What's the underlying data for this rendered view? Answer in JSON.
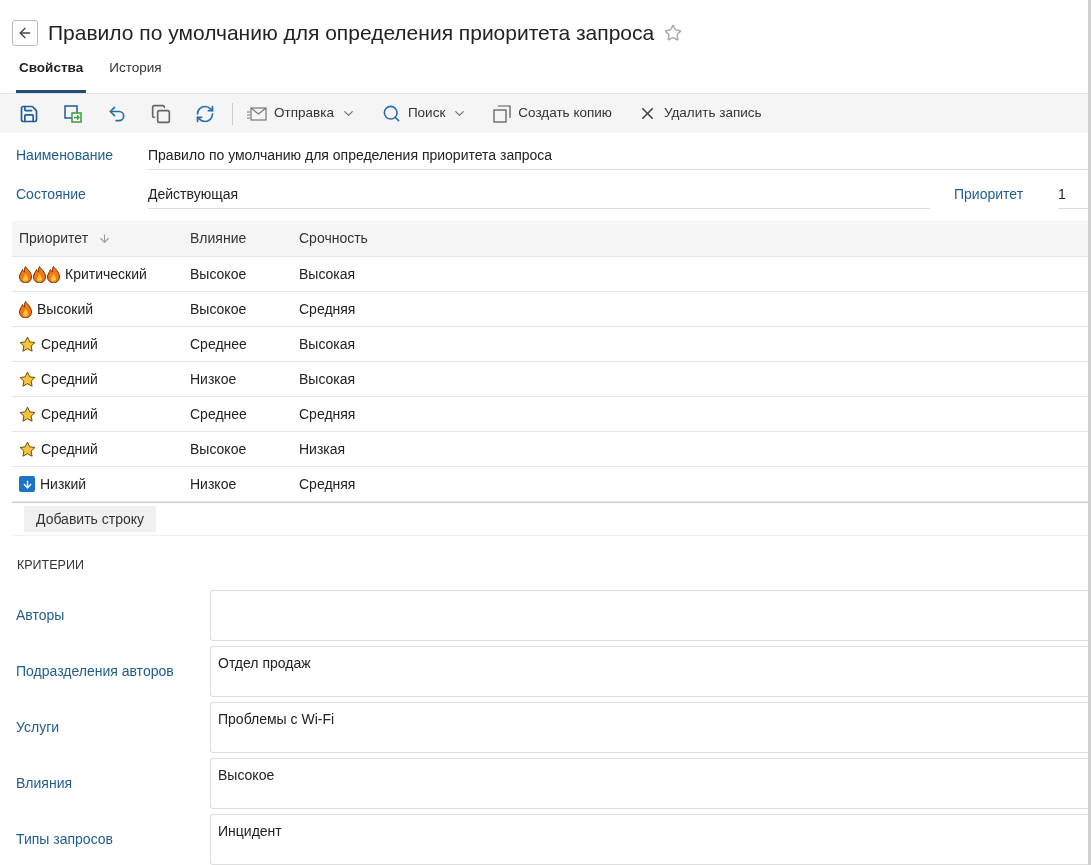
{
  "header": {
    "title": "Правило по умолчанию для определения приоритета запроса",
    "favorite": false
  },
  "tabs": [
    {
      "label": "Свойства",
      "selected": true
    },
    {
      "label": "История",
      "selected": false
    }
  ],
  "toolbar": {
    "icon_buttons": [
      {
        "kind": "save"
      },
      {
        "kind": "save-close"
      },
      {
        "kind": "undo"
      },
      {
        "kind": "copy"
      },
      {
        "kind": "refresh"
      }
    ],
    "buttons": [
      {
        "kind": "send",
        "label": "Отправка",
        "dropdown": true
      },
      {
        "kind": "search",
        "label": "Поиск",
        "dropdown": true
      },
      {
        "kind": "duplicate",
        "label": "Создать копию",
        "dropdown": false
      },
      {
        "kind": "delete",
        "label": "Удалить запись",
        "dropdown": false
      }
    ]
  },
  "fields": {
    "name": {
      "label": "Наименование",
      "value": "Правило по умолчанию для определения приоритета запроса"
    },
    "state": {
      "label": "Состояние",
      "value": "Действующая"
    },
    "priority": {
      "label": "Приоритет",
      "value": "1"
    }
  },
  "table": {
    "columns": [
      "Приоритет",
      "Влияние",
      "Срочность"
    ],
    "rows": [
      {
        "kind": "critical",
        "priority": "Критический",
        "impact": "Высокое",
        "urgency": "Высокая"
      },
      {
        "kind": "high",
        "priority": "Высокий",
        "impact": "Высокое",
        "urgency": "Средняя"
      },
      {
        "kind": "medium",
        "priority": "Средний",
        "impact": "Среднее",
        "urgency": "Высокая"
      },
      {
        "kind": "medium",
        "priority": "Средний",
        "impact": "Низкое",
        "urgency": "Высокая"
      },
      {
        "kind": "medium",
        "priority": "Средний",
        "impact": "Среднее",
        "urgency": "Средняя"
      },
      {
        "kind": "medium",
        "priority": "Средний",
        "impact": "Высокое",
        "urgency": "Низкая"
      },
      {
        "kind": "low",
        "priority": "Низкий",
        "impact": "Низкое",
        "urgency": "Средняя"
      }
    ],
    "add_button": "Добавить строку"
  },
  "criteria": {
    "title": "КРИТЕРИИ",
    "fields": [
      {
        "label": "Авторы"
      },
      {
        "label": "Подразделения авторов",
        "value": "Отдел продаж"
      },
      {
        "label": "Услуги",
        "value": "Проблемы с Wi-Fi"
      },
      {
        "label": "Влияния",
        "value": "Высокое"
      },
      {
        "label": "Типы запросов",
        "value": "Инцидент"
      }
    ]
  }
}
